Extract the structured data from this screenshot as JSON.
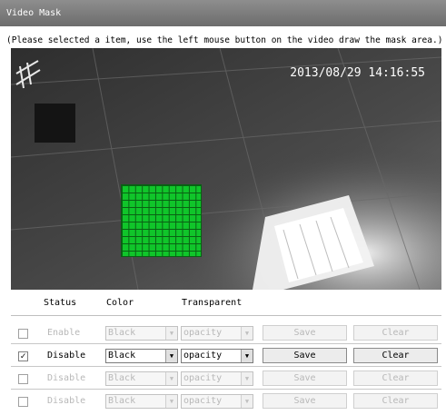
{
  "window": {
    "title": "Video Mask"
  },
  "hint": "(Please selected a item, use the left mouse button on the video draw the mask area.)",
  "video": {
    "timestamp": "2013/08/29 14:16:55"
  },
  "columns": {
    "status": "Status",
    "color": "Color",
    "transparent": "Transparent"
  },
  "rows": [
    {
      "checked": false,
      "checkmark": "",
      "status": "Enable",
      "color": "Black",
      "transparent": "opacity",
      "save": "Save",
      "clear": "Clear",
      "enabled": false
    },
    {
      "checked": true,
      "checkmark": "✓",
      "status": "Disable",
      "color": "Black",
      "transparent": "opacity",
      "save": "Save",
      "clear": "Clear",
      "enabled": true
    },
    {
      "checked": false,
      "checkmark": "",
      "status": "Disable",
      "color": "Black",
      "transparent": "opacity",
      "save": "Save",
      "clear": "Clear",
      "enabled": false
    },
    {
      "checked": false,
      "checkmark": "",
      "status": "Disable",
      "color": "Black",
      "transparent": "opacity",
      "save": "Save",
      "clear": "Clear",
      "enabled": false
    }
  ],
  "colors": {
    "mask_grid": "#10c52a",
    "mask_dark": "#141414",
    "titlebar": "#7d7d7d"
  },
  "icons": {
    "dropdown": "triangle-down-icon",
    "checkbox_mark": "check-icon"
  }
}
